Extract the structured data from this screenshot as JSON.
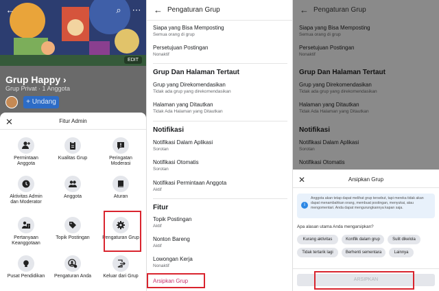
{
  "panel1": {
    "group_name": "Grup Happy",
    "group_chevron": "›",
    "group_privacy": "Grup Privat · 1 Anggota",
    "join_label": "+ Undang",
    "edit_label": "EDIT",
    "sheet_title": "Fitur Admin",
    "tiles": [
      {
        "label": "Permintaan Anggota",
        "icon": "person-add-icon"
      },
      {
        "label": "Kualitas Grup",
        "icon": "clipboard-icon"
      },
      {
        "label": "Peringatan Moderasi",
        "icon": "alert-chat-icon"
      },
      {
        "label": "Aktivitas Admin dan Moderator",
        "icon": "clock-icon"
      },
      {
        "label": "Anggota",
        "icon": "people-icon"
      },
      {
        "label": "Aturan",
        "icon": "book-icon"
      },
      {
        "label": "Pertanyaan Keanggotaan",
        "icon": "question-doc-icon"
      },
      {
        "label": "Topik Postingan",
        "icon": "tag-icon"
      },
      {
        "label": "Pengaturan Grup",
        "icon": "gear-icon"
      },
      {
        "label": "Pusat Pendidikan",
        "icon": "lightbulb-icon"
      },
      {
        "label": "Pengaturan Anda",
        "icon": "person-gear-icon"
      },
      {
        "label": "Keluar dari Grup",
        "icon": "exit-icon"
      }
    ]
  },
  "panel2": {
    "title": "Pengaturan Grup",
    "rows": [
      {
        "title": "Siapa yang Bisa Memposting",
        "sub": "Semua orang di grup"
      },
      {
        "title": "Persetujuan Postingan",
        "sub": "Nonaktif"
      }
    ],
    "section1": "Grup Dan Halaman Tertaut",
    "rows1": [
      {
        "title": "Grup yang Direkomendasikan",
        "sub": "Tidak ada grup yang direkomendasikan"
      },
      {
        "title": "Halaman yang Ditautkan",
        "sub": "Tidak Ada Halaman yang Ditautkan"
      }
    ],
    "section2": "Notifikasi",
    "rows2": [
      {
        "title": "Notifikasi Dalam Aplikasi",
        "sub": "Sorotan"
      },
      {
        "title": "Notifikasi Otomatis",
        "sub": "Sorotan"
      },
      {
        "title": "Notifikasi Permintaan Anggota",
        "sub": "Aktif"
      }
    ],
    "section3": "Fitur",
    "rows3": [
      {
        "title": "Topik Postingan",
        "sub": "Aktif"
      },
      {
        "title": "Nonton Bareng",
        "sub": "Aktif"
      },
      {
        "title": "Lowongan Kerja",
        "sub": "Nonaktif"
      }
    ],
    "archive_label": "Arsipkan Grup"
  },
  "panel3": {
    "title": "Pengaturan Grup",
    "rows": [
      {
        "title": "Siapa yang Bisa Memposting",
        "sub": "Semua orang di grup"
      },
      {
        "title": "Persetujuan Postingan",
        "sub": "Nonaktif"
      }
    ],
    "section1": "Grup Dan Halaman Tertaut",
    "rows1": [
      {
        "title": "Grup yang Direkomendasikan",
        "sub": "Tidak ada grup yang direkomendasikan"
      },
      {
        "title": "Halaman yang Ditautkan",
        "sub": "Tidak Ada Halaman yang Ditautkan"
      }
    ],
    "section2": "Notifikasi",
    "rows2": [
      {
        "title": "Notifikasi Dalam Aplikasi",
        "sub": "Sorotan"
      },
      {
        "title": "Notifikasi Otomatis",
        "sub": "Sorotan"
      }
    ],
    "sheet_title": "Arsipkan Grup",
    "info_text": "Anggota akan tetap dapat melihat grup tersebut, tapi mereka tidak akan dapat menambahkan orang, membuat postingan, menyukai, atau mengomentari. Anda dapat mengurungkannya kapan saja.",
    "question": "Apa alasan utama Anda mengarsipkan?",
    "chips": [
      "Kurang aktivitas",
      "Konflik dalam grup",
      "Sulit dikelola",
      "Tidak tertarik lagi",
      "Berhenti sementara",
      "Lainnya"
    ],
    "archive_button": "ARSIPKAN"
  },
  "colors": {
    "accent_blue": "#2d6cc6",
    "highlight_red": "#d9232d",
    "archive_pink": "#c4306a"
  }
}
